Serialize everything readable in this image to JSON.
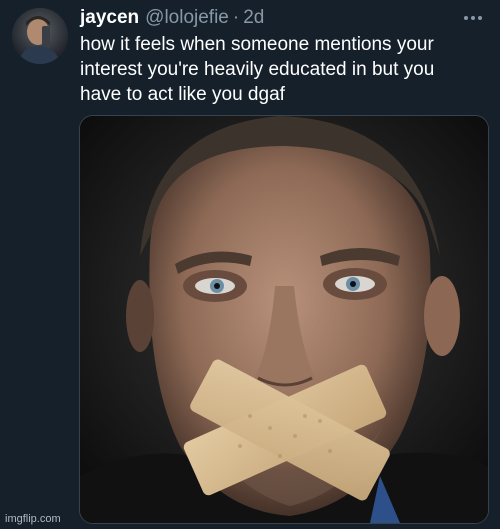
{
  "tweet": {
    "author": {
      "display_name": "jaycen",
      "handle": "@lolojefie",
      "separator": "·",
      "timestamp": "2d"
    },
    "text": "how it feels when someone mentions your\ninterest you're heavily educated in but you\nhave to act like you dgaf",
    "media": {
      "subject": "close-up portrait of a man with tape crossed over his mouth"
    },
    "more_icon": "ellipsis-icon"
  },
  "watermark": "imgflip.com",
  "colors": {
    "background": "#15202b",
    "secondary_text": "#8899a6",
    "primary_text": "#ffffff",
    "border": "#38444d"
  }
}
